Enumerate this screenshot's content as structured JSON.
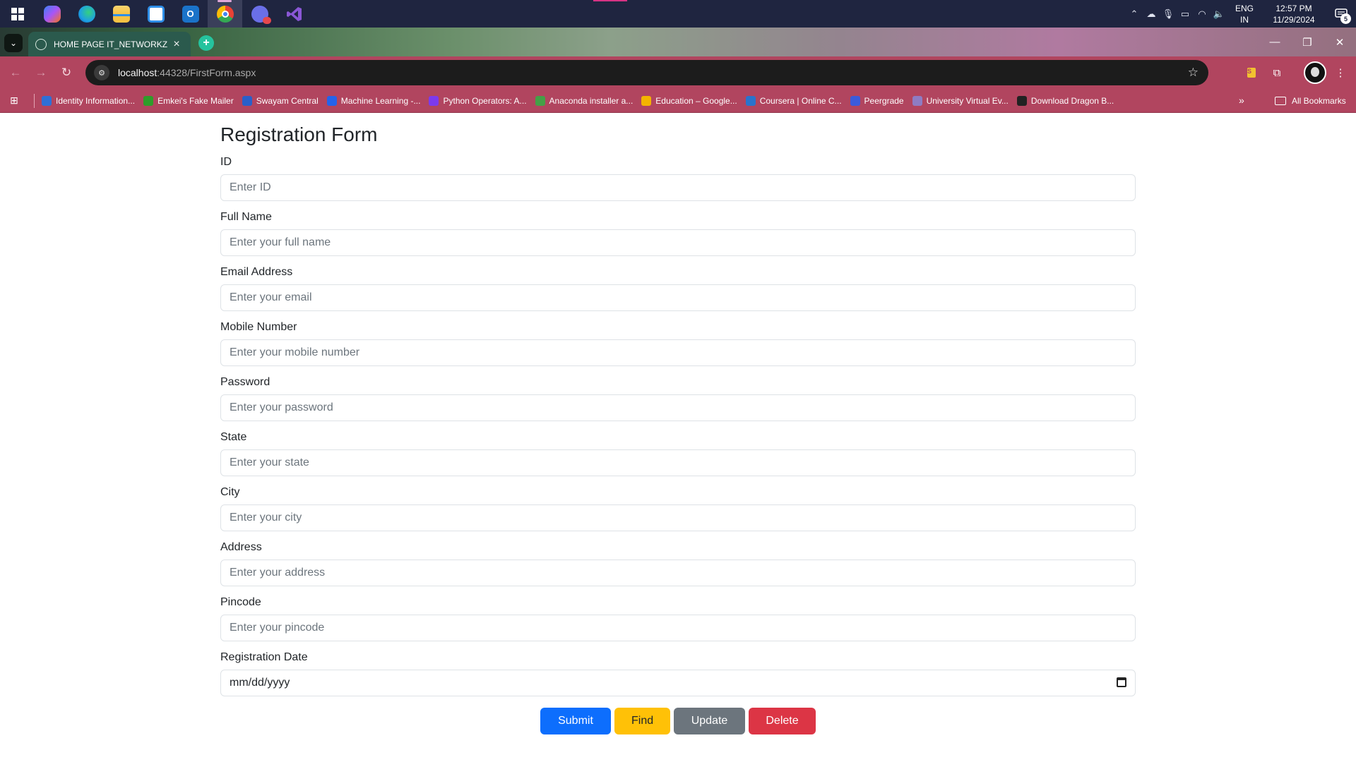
{
  "taskbar": {
    "apps": [
      {
        "name": "windows-start-icon",
        "color": "#ffffff"
      },
      {
        "name": "copilot-icon",
        "color": "#7b5cff"
      },
      {
        "name": "edge-icon",
        "color": "#1da0e4"
      },
      {
        "name": "file-explorer-icon",
        "color": "#f6c244"
      },
      {
        "name": "microsoft-store-icon",
        "color": "#2f8fe8"
      },
      {
        "name": "outlook-icon",
        "color": "#1a73c9"
      },
      {
        "name": "chrome-icon",
        "color": "#e94235"
      },
      {
        "name": "discord-icon",
        "color": "#6a6fe8"
      },
      {
        "name": "visual-studio-icon",
        "color": "#8a57d6"
      }
    ],
    "language_top": "ENG",
    "language_bottom": "IN",
    "time": "12:57 PM",
    "date": "11/29/2024",
    "notification_count": "5"
  },
  "browser": {
    "tab_title": "HOME PAGE IT_NETWORKZ",
    "url_host": "localhost",
    "url_path": ":44328/FirstForm.aspx",
    "bookmarks": [
      {
        "label": "Identity Information...",
        "color": "#2f6fd6"
      },
      {
        "label": "Emkei's Fake Mailer",
        "color": "#2f9d2a"
      },
      {
        "label": "Swayam Central",
        "color": "#2a5fc9"
      },
      {
        "label": "Machine Learning -...",
        "color": "#2563eb"
      },
      {
        "label": "Python Operators: A...",
        "color": "#7c3aed"
      },
      {
        "label": "Anaconda installer a...",
        "color": "#44a047"
      },
      {
        "label": "Education – Google...",
        "color": "#f4b400"
      },
      {
        "label": "Coursera | Online C...",
        "color": "#2a73cc"
      },
      {
        "label": "Peergrade",
        "color": "#3b5bdb"
      },
      {
        "label": "University Virtual Ev...",
        "color": "#8e7cc3"
      },
      {
        "label": "Download Dragon B...",
        "color": "#222222"
      }
    ],
    "all_bookmarks_label": "All Bookmarks"
  },
  "form": {
    "title": "Registration Form",
    "fields": [
      {
        "label": "ID",
        "placeholder": "Enter ID"
      },
      {
        "label": "Full Name",
        "placeholder": "Enter your full name"
      },
      {
        "label": "Email Address",
        "placeholder": "Enter your email"
      },
      {
        "label": "Mobile Number",
        "placeholder": "Enter your mobile number"
      },
      {
        "label": "Password",
        "placeholder": "Enter your password"
      },
      {
        "label": "State",
        "placeholder": "Enter your state"
      },
      {
        "label": "City",
        "placeholder": "Enter your city"
      },
      {
        "label": "Address",
        "placeholder": "Enter your address"
      },
      {
        "label": "Pincode",
        "placeholder": "Enter your pincode"
      }
    ],
    "date_field": {
      "label": "Registration Date",
      "value": "mm/dd/yyyy"
    },
    "buttons": {
      "submit": "Submit",
      "find": "Find",
      "update": "Update",
      "delete": "Delete"
    }
  }
}
